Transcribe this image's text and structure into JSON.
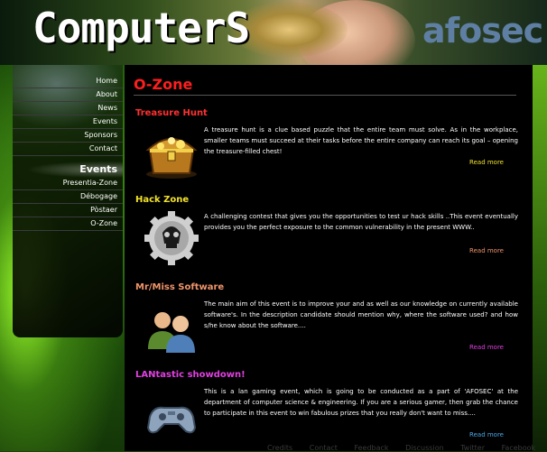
{
  "header": {
    "site_title": "ComputerS",
    "brand": "afosec"
  },
  "sidebar": {
    "main_items": [
      {
        "label": "Home"
      },
      {
        "label": "About"
      },
      {
        "label": "News"
      },
      {
        "label": "Events"
      },
      {
        "label": "Sponsors"
      },
      {
        "label": "Contact"
      }
    ],
    "section_title": "Events",
    "sub_items": [
      {
        "label": "Presentia-Zone"
      },
      {
        "label": "Débogage"
      },
      {
        "label": "Pòstaer"
      },
      {
        "label": "O-Zone"
      }
    ]
  },
  "main": {
    "page_title": "O-Zone",
    "events": [
      {
        "title": "Treasure Hunt",
        "title_color": "#ff3030",
        "icon": "treasure-chest-icon",
        "description": "A treasure hunt is a clue based puzzle that the entire team must solve. As in the workplace, smaller teams must succeed at their tasks before the entire company can reach its goal – opening the treasure-filled chest!",
        "read_more": "Read more",
        "read_more_color": "#f2e22a"
      },
      {
        "title": "Hack Zone",
        "title_color": "#f2e22a",
        "icon": "skull-gear-icon",
        "description": "A challenging contest that gives you the opportunities to test ur hack skills ..This event eventually provides you the perfect exposure to the common vulnerability in the present WWW..",
        "read_more": "Read more",
        "read_more_color": "#f0956a"
      },
      {
        "title": "Mr/Miss Software",
        "title_color": "#f0956a",
        "icon": "users-icon",
        "description": "The main aim of this event is to improve your and as well as our knowledge on currently available software's. In the description candidate should mention why, where the software used? and how s/he know about the software....",
        "read_more": "Read more",
        "read_more_color": "#e040e0"
      },
      {
        "title": "LANtastic showdown!",
        "title_color": "#e040e0",
        "icon": "gamepad-icon",
        "description": "This is a lan gaming event, which is going to be conducted as a part of 'AFOSEC' at the department of computer science & engineering. If you are a serious gamer, then grab the chance to participate in this event to win fabulous prizes that you really don't want to miss....",
        "read_more": "Read more",
        "read_more_color": "#4aa8e8"
      }
    ]
  },
  "footer": {
    "links": [
      "Credits",
      "Contact",
      "Feedback",
      "Discussion",
      "Twitter",
      "Facebook"
    ]
  }
}
